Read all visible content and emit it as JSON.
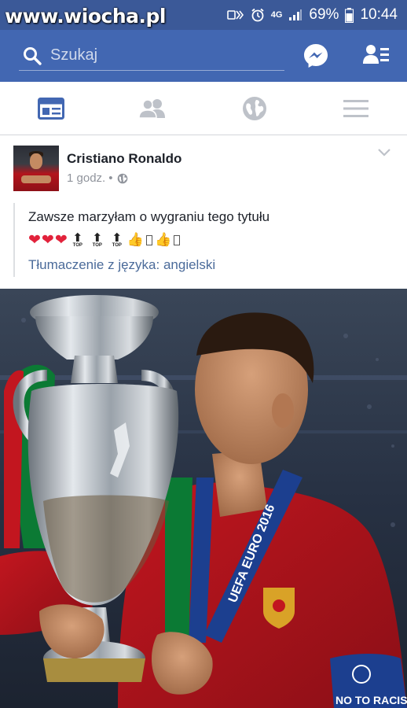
{
  "watermark": "www.wiocha.pl",
  "status": {
    "network": "4G",
    "battery": "69%",
    "time": "10:44"
  },
  "search": {
    "placeholder": "Szukaj"
  },
  "tabs": [
    {
      "icon": "news-feed-icon",
      "active": true
    },
    {
      "icon": "friends-icon",
      "active": false
    },
    {
      "icon": "globe-icon",
      "active": false
    },
    {
      "icon": "menu-icon",
      "active": false
    }
  ],
  "post": {
    "author": "Cristiano Ronaldo",
    "time": "1 godz.",
    "separator": "•",
    "text": "Zawsze marzyłam o wygraniu tego tytułu",
    "top_label": "TOP",
    "translate": "Tłumaczenie z języka: angielski",
    "photo": {
      "banner_text": "UEFA EURO 2016",
      "armband_text": "NO TO RACISM"
    }
  },
  "colors": {
    "brand_dark": "#3b5998",
    "brand": "#4267b2",
    "active_tab": "#4267b2",
    "inactive_tab": "#bec2c9",
    "heart": "#e2223b"
  }
}
